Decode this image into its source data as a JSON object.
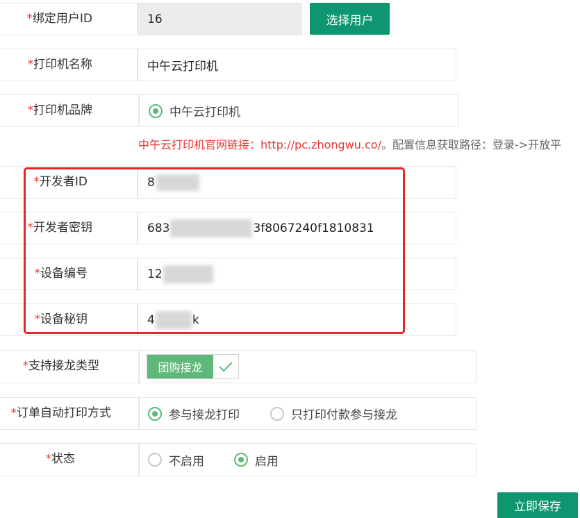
{
  "form": {
    "required_mark": "*",
    "bind_user_id": {
      "label": "绑定用户ID",
      "value": "16",
      "button": "选择用户"
    },
    "printer_name": {
      "label": "打印机名称",
      "value": "中午云打印机"
    },
    "printer_brand": {
      "label": "打印机品牌",
      "option": "中午云打印机"
    },
    "brand_note": {
      "link_text": "中午云打印机官网链接：http://pc.zhongwu.co/",
      "rest_text": "。配置信息获取路径：登录->开放平"
    },
    "developer_id": {
      "label": "开发者ID",
      "value": "8"
    },
    "developer_key": {
      "label": "开发者密钥",
      "value_start": "683",
      "value_end": "3f8067240f1810831"
    },
    "device_no": {
      "label": "设备编号",
      "value": "12"
    },
    "device_secret": {
      "label": "设备秘钥",
      "value_start": "4",
      "value_end": "k"
    },
    "support_type": {
      "label": "支持接龙类型",
      "tag": "团购接龙"
    },
    "auto_print": {
      "label": "订单自动打印方式",
      "options": [
        "参与接龙打印",
        "只打印付款参与接龙"
      ],
      "selected": "参与接龙打印"
    },
    "status": {
      "label": "状态",
      "options": [
        "不启用",
        "启用"
      ],
      "selected": "启用"
    },
    "save_button": "立即保存"
  },
  "colors": {
    "accent": "#0e9670",
    "radio_on": "#5fb878",
    "note_red": "#e53935",
    "highlight_box": "#e82424"
  }
}
